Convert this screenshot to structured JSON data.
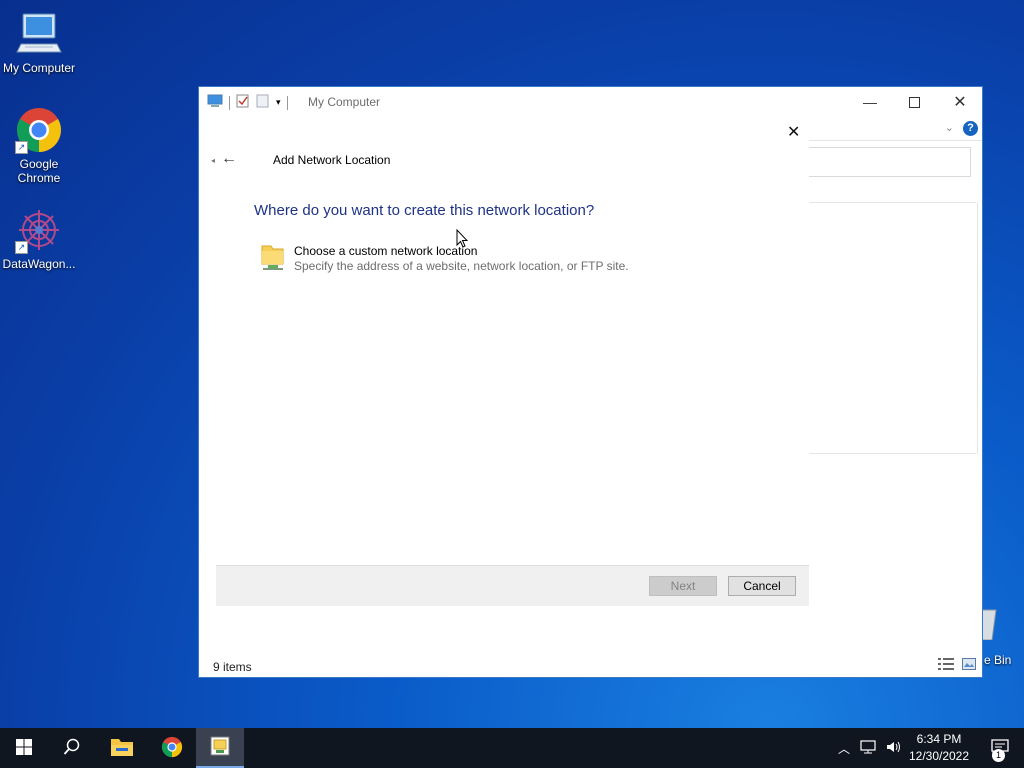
{
  "desktop": {
    "icons": [
      {
        "label": "My Computer"
      },
      {
        "label": "Google Chrome"
      },
      {
        "label": "DataWagon..."
      }
    ],
    "recycle_bin_label": "e Bin"
  },
  "explorer": {
    "title": "My Computer",
    "status_items": "9 items",
    "help_label": "?"
  },
  "wizard": {
    "title": "Add Network Location",
    "heading": "Where do you want to create this network location?",
    "option": {
      "label": "Choose a custom network location",
      "description": "Specify the address of a website, network location, or FTP site."
    },
    "next_label": "Next",
    "cancel_label": "Cancel",
    "next_enabled": false
  },
  "taskbar": {
    "time": "6:34 PM",
    "date": "12/30/2022",
    "notification_count": "1"
  },
  "colors": {
    "accent": "#1565c0",
    "heading": "#1e3287",
    "taskbar": "#101620"
  }
}
